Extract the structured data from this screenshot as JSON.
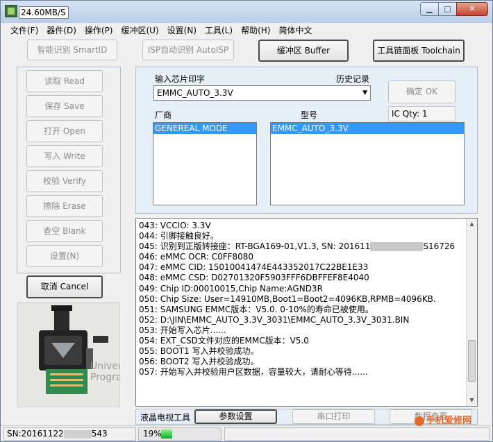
{
  "window": {
    "title_value": "24.60MB/S"
  },
  "menu": [
    "文件(F)",
    "器件(D)",
    "操作(P)",
    "缓冲区(U)",
    "设置(N)",
    "工具(L)",
    "帮助(H)",
    "简体中文"
  ],
  "toolbar": {
    "smartid": "智能识别 SmartID",
    "autoisp": "ISP自动识别 AutoISP",
    "buffer": "缓冲区 Buffer",
    "toolchain": "工具链面板 Toolchain"
  },
  "ops": [
    "读取 Read",
    "保存 Save",
    "打开 Open",
    "写入 Write",
    "校验 Verify",
    "擦除 Erase",
    "查空 Blank",
    "设置(N)"
  ],
  "cancel": "取消 Cancel",
  "chip": {
    "input_label": "输入芯片印字",
    "history_label": "历史记录",
    "combo_value": "EMMC_AUTO_3.3V",
    "ok": "确定 OK",
    "ic_qty": "IC Qty: 1",
    "vendor_label": "厂商",
    "model_label": "型号",
    "vendors": [
      "GENEREAL MODE"
    ],
    "models": [
      "EMMC_AUTO_3.3V"
    ]
  },
  "log": {
    "lines": [
      "043:  VCCIO: 3.3V",
      "044:  引脚接触良好。",
      "045:  识别到正版转接座：RT-BGA169-01,V1.3, SN: 201611",
      "046:  eMMC OCR: C0FF8080",
      "047:  eMMC CID:  15010041474E443352017C22BE1E33",
      "048:  eMMC CSD: D02701320F5903FFF6DBFFEF8E4040",
      "049:  Chip ID:00010015,Chip Name:AGND3R",
      "050:  Chip Size: User=14910MB,Boot1=Boot2=4096KB,RPMB=4096KB.",
      "051:  SAMSUNG EMMC版本：V5.0.   0-10%的寿命已被使用。",
      "052:  D:\\JIN\\EMMC_AUTO_3.3V_3031\\EMMC_AUTO_3.3V_3031.BIN",
      "053:  开始写入芯片......",
      "054:  EXT_CSD文件对应的EMMC版本：V5.0",
      "055:  BOOT1 写入并校验成功。",
      "056:  BOOT2 写入并校验成功。",
      "057:  开始写入并校验用户区数据，容量较大，请耐心等待......"
    ],
    "line045_tail": "S16726"
  },
  "bottom": {
    "lcd_label": "液晶电视工具",
    "params": "参数设置",
    "serial": "串口打印",
    "tutorial": "教程查看"
  },
  "photo": {
    "univ": "Univer",
    "prog": "Progran"
  },
  "status": {
    "sn_prefix": "SN:20161122",
    "sn_suffix": "543",
    "progress_text": "19%",
    "progress_fraction": 0.19
  },
  "watermark": "手机爱修网",
  "colors": {
    "selection": "#3399ff",
    "progress": "#06b025",
    "panel": "#e6eef8"
  }
}
